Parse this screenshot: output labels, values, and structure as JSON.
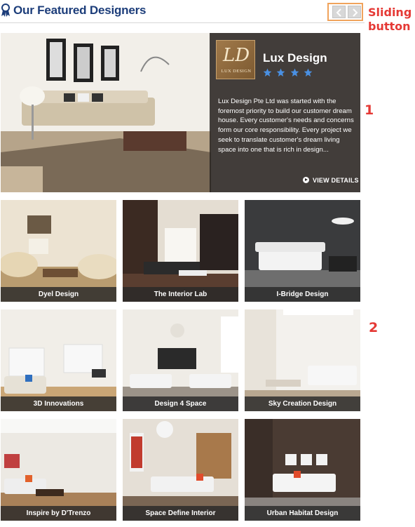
{
  "header": {
    "title": "Our Featured Designers",
    "icon": "award-ribbon-icon"
  },
  "slider": {
    "prev_icon": "chevron-left-icon",
    "next_icon": "chevron-right-icon"
  },
  "annotations": {
    "sliding_button": "Sliding button",
    "marker_1": "1",
    "marker_2": "2",
    "color": "#e53935"
  },
  "featured": {
    "logo_text": "LUX DESIGN",
    "name": "Lux Design",
    "rating": 4,
    "description": "Lux Design Pte Ltd was started with the foremost priority to build our customer dream house. Every customer's needs and concerns form our core responsibility. Every project we seek to translate customer's dream living space into one that is rich in design...",
    "cta": "VIEW DETAILS"
  },
  "designers": [
    {
      "label": "Dyel Design"
    },
    {
      "label": "The Interior Lab"
    },
    {
      "label": "I-Bridge Design"
    },
    {
      "label": "3D Innovations"
    },
    {
      "label": "Design 4 Space"
    },
    {
      "label": "Sky Creation Design"
    },
    {
      "label": "Inspire by D'Trenzo"
    },
    {
      "label": "Space Define Interior"
    },
    {
      "label": "Urban Habitat Design"
    }
  ],
  "colors": {
    "title": "#1c3d7a",
    "accent_border": "#f0a35c",
    "star": "#4a90e2"
  }
}
